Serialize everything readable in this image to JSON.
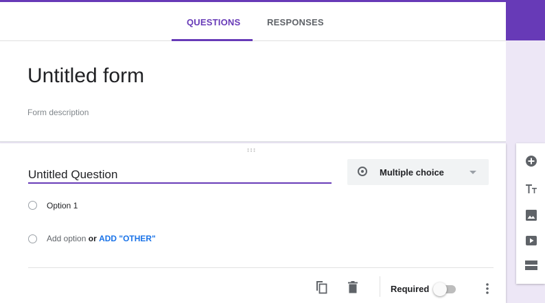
{
  "tabs": [
    {
      "label": "QUESTIONS",
      "active": true
    },
    {
      "label": "RESPONSES",
      "active": false
    }
  ],
  "form": {
    "title": "Untitled form",
    "description_placeholder": "Form description"
  },
  "question": {
    "title": "Untitled Question",
    "type": "Multiple choice",
    "options": [
      {
        "label": "Option 1"
      }
    ],
    "add_option": {
      "label": "Add option",
      "or": "or",
      "other": "ADD \"OTHER\""
    },
    "required_label": "Required",
    "required": false
  },
  "toolbar": {
    "icons": [
      "add-question-icon",
      "add-title-icon",
      "add-image-icon",
      "add-video-icon",
      "add-section-icon"
    ]
  },
  "colors": {
    "accent": "#673ab7",
    "background": "#ede7f6",
    "link": "#1a73e8",
    "icon": "#5f6368"
  }
}
